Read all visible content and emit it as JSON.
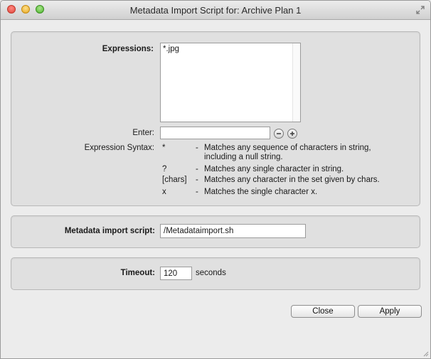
{
  "window": {
    "title": "Metadata Import Script for: Archive Plan 1"
  },
  "expressions": {
    "label": "Expressions:",
    "items": [
      "*.jpg"
    ],
    "enter_label": "Enter:",
    "enter_value": "",
    "syntax_label": "Expression Syntax:",
    "syntax": [
      {
        "token": "*",
        "dash": "-",
        "desc": "Matches any sequence of characters in string,",
        "desc2": "including a null string."
      },
      {
        "token": "?",
        "dash": "-",
        "desc": "Matches any single character in string."
      },
      {
        "token": "[chars]",
        "dash": "-",
        "desc": "Matches any character in the set given by chars."
      },
      {
        "token": "x",
        "dash": "-",
        "desc": "Matches the single character x."
      }
    ]
  },
  "script": {
    "label": "Metadata import script:",
    "value": "/Metadataimport.sh"
  },
  "timeout": {
    "label": "Timeout:",
    "value": "120",
    "unit": "seconds"
  },
  "buttons": {
    "close": "Close",
    "apply": "Apply"
  }
}
